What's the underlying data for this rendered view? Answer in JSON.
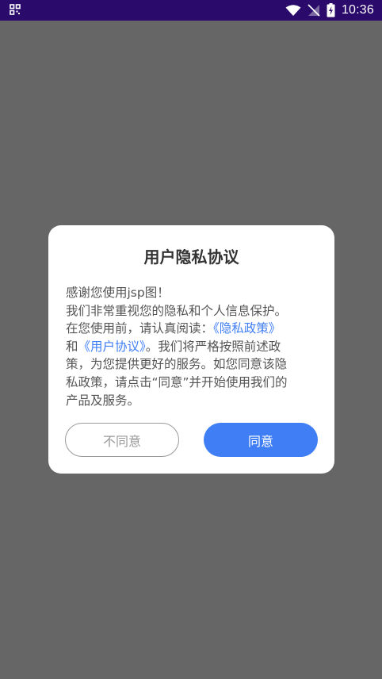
{
  "status_bar": {
    "time": "10:36",
    "icons": [
      "qr-scan-icon",
      "wifi-icon",
      "no-signal-icon",
      "battery-charging-icon"
    ]
  },
  "dialog": {
    "title": "用户隐私协议",
    "body": {
      "line1": "感谢您使用jsp图！",
      "line2": "我们非常重视您的隐私和个人信息保护。",
      "line3_prefix": "在您使用前，请认真阅读：",
      "privacy_link": "《隐私政策》",
      "line4_prefix": "和",
      "agreement_link": "《用户协议》",
      "line4_suffix": "。我们将严格按照前述政",
      "line5": "策，为您提供更好的服务。如您同意该隐",
      "line6": "私政策，请点击“同意”并开始使用我们的",
      "line7": "产品及服务。"
    },
    "disagree_label": "不同意",
    "agree_label": "同意"
  },
  "colors": {
    "status_bar": "#2a0a6b",
    "overlay": "#666666",
    "accent": "#3f7ef5"
  }
}
